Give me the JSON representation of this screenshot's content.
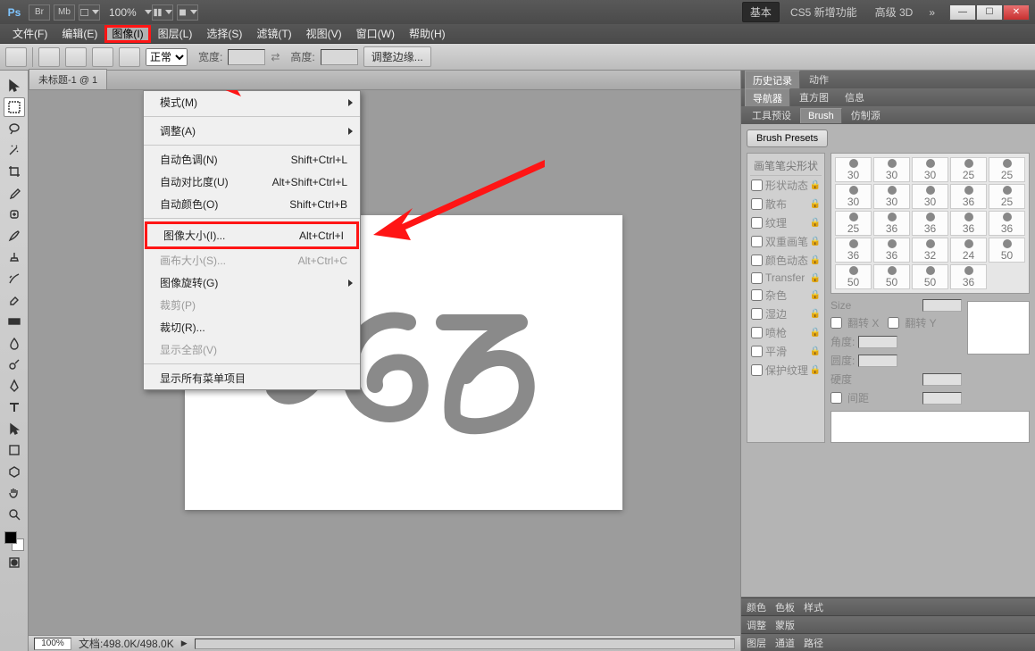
{
  "titlebar": {
    "ps": "Ps",
    "br": "Br",
    "mb": "Mb",
    "zoom": "100%",
    "workspace_basic": "基本",
    "workspace_cs5": "CS5 新增功能",
    "workspace_3d": "高级 3D",
    "chevron": "»"
  },
  "menubar": {
    "file": "文件(F)",
    "edit": "编辑(E)",
    "image": "图像(I)",
    "layer": "图层(L)",
    "select": "选择(S)",
    "filter": "滤镜(T)",
    "view": "视图(V)",
    "window": "窗口(W)",
    "help": "帮助(H)"
  },
  "image_menu": {
    "mode": "模式(M)",
    "adjustments": "调整(A)",
    "auto_tone": {
      "label": "自动色调(N)",
      "shortcut": "Shift+Ctrl+L"
    },
    "auto_contrast": {
      "label": "自动对比度(U)",
      "shortcut": "Alt+Shift+Ctrl+L"
    },
    "auto_color": {
      "label": "自动颜色(O)",
      "shortcut": "Shift+Ctrl+B"
    },
    "image_size": {
      "label": "图像大小(I)...",
      "shortcut": "Alt+Ctrl+I"
    },
    "canvas_size": {
      "label": "画布大小(S)...",
      "shortcut": "Alt+Ctrl+C"
    },
    "image_rotation": "图像旋转(G)",
    "crop": "裁剪(P)",
    "trim": "裁切(R)...",
    "reveal_all": "显示全部(V)",
    "show_all_menu": "显示所有菜单项目"
  },
  "options": {
    "mode_select": "正常",
    "width_label": "宽度:",
    "swap": "⇄",
    "height_label": "高度:",
    "refine_edge": "调整边缘..."
  },
  "doc": {
    "tab": "未标题-1 @ 1"
  },
  "statusbar": {
    "zoom": "100%",
    "docinfo": "文档:498.0K/498.0K"
  },
  "panels": {
    "history_tabs": {
      "history": "历史记录",
      "actions": "动作"
    },
    "nav_tabs": {
      "navigator": "导航器",
      "histogram": "直方图",
      "info": "信息"
    },
    "brush_tabs": {
      "tool_presets": "工具预设",
      "brush": "Brush",
      "clone_source": "仿制源"
    },
    "brush_presets_btn": "Brush Presets",
    "brush_left": {
      "head": "画笔笔尖形状",
      "r1": "形状动态",
      "r2": "散布",
      "r3": "纹理",
      "r4": "双重画笔",
      "r5": "颜色动态",
      "r6": "Transfer",
      "r7": "杂色",
      "r8": "湿边",
      "r9": "喷枪",
      "r10": "平滑",
      "r11": "保护纹理"
    },
    "brush_sizes": [
      "30",
      "30",
      "30",
      "25",
      "25",
      "30",
      "30",
      "30",
      "36",
      "25",
      "25",
      "36",
      "36",
      "36",
      "36",
      "36",
      "36",
      "32",
      "24",
      "50",
      "50",
      "50",
      "50",
      "36"
    ],
    "brush_opts": {
      "size": "Size",
      "flipx": "翻转 X",
      "flipy": "翻转 Y",
      "angle": "角度:",
      "roundness": "圆度:",
      "hardness": "硬度",
      "spacing": "间距"
    },
    "bottom1": {
      "color": "颜色",
      "swatches": "色板",
      "styles": "样式"
    },
    "bottom2": {
      "adjust": "调整",
      "masks": "蒙版"
    },
    "bottom3": {
      "layers": "图层",
      "channels": "通道",
      "paths": "路径"
    }
  }
}
